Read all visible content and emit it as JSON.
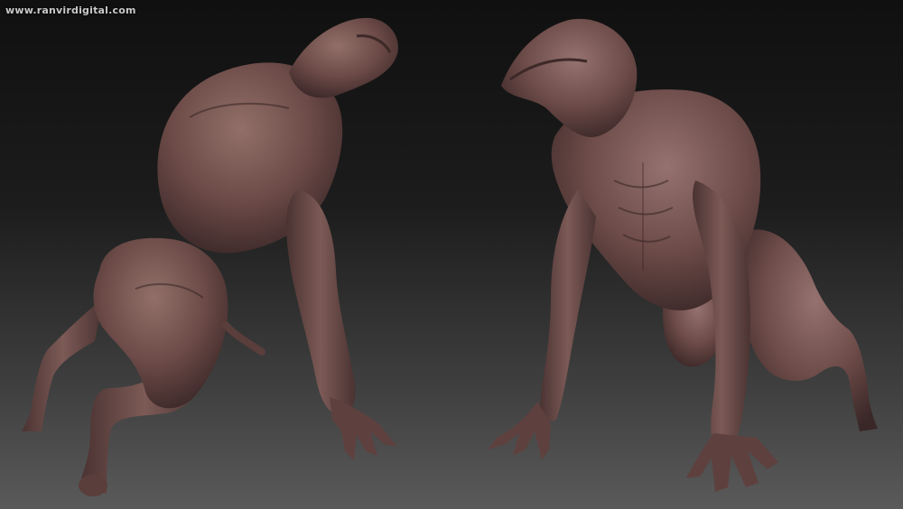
{
  "watermark": {
    "text": "www.ranvirdigital.com"
  },
  "palette": {
    "skin": "#6b4a47",
    "skin_light": "#8e6b66",
    "skin_dark": "#3e2a29",
    "background_top": "#101010",
    "background_bottom": "#5a5a5a"
  }
}
